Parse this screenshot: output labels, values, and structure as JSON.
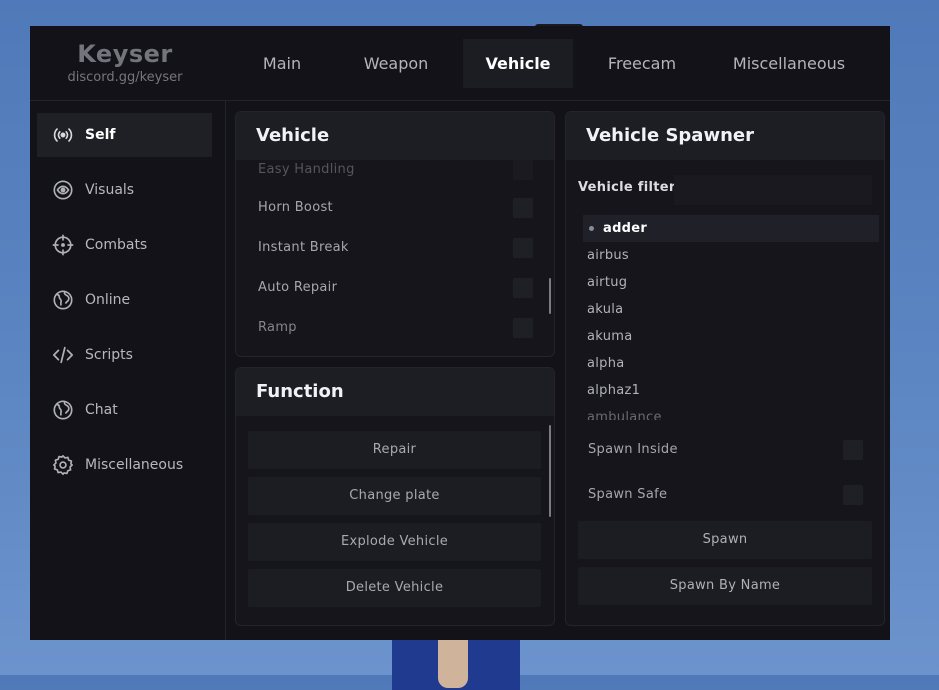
{
  "brand": {
    "title": "Keyser",
    "subtitle": "discord.gg/keyser"
  },
  "tabs": [
    {
      "label": "Main"
    },
    {
      "label": "Weapon"
    },
    {
      "label": "Vehicle",
      "active": true
    },
    {
      "label": "Freecam"
    },
    {
      "label": "Miscellaneous"
    }
  ],
  "sidebar": {
    "items": [
      {
        "label": "Self",
        "icon": "broadcast-icon",
        "active": true
      },
      {
        "label": "Visuals",
        "icon": "eye-icon"
      },
      {
        "label": "Combats",
        "icon": "crosshair-icon"
      },
      {
        "label": "Online",
        "icon": "globe-icon"
      },
      {
        "label": "Scripts",
        "icon": "code-icon"
      },
      {
        "label": "Chat",
        "icon": "globe-icon"
      },
      {
        "label": "Miscellaneous",
        "icon": "gear-icon"
      }
    ]
  },
  "vehicle_panel": {
    "title": "Vehicle",
    "options": [
      {
        "label": "Easy Handling",
        "checked": false
      },
      {
        "label": "Horn Boost",
        "checked": false
      },
      {
        "label": "Instant Break",
        "checked": false
      },
      {
        "label": "Auto Repair",
        "checked": false
      },
      {
        "label": "Ramp",
        "checked": false
      }
    ]
  },
  "function_panel": {
    "title": "Function",
    "buttons": [
      {
        "label": "Repair"
      },
      {
        "label": "Change plate"
      },
      {
        "label": "Explode Vehicle"
      },
      {
        "label": "Delete Vehicle"
      }
    ]
  },
  "spawner_panel": {
    "title": "Vehicle Spawner",
    "filter_label": "Vehicle filter",
    "filter_value": "",
    "vehicles": [
      "adder",
      "airbus",
      "airtug",
      "akula",
      "akuma",
      "alpha",
      "alphaz1",
      "ambulance"
    ],
    "selected_vehicle": "adder",
    "options": [
      {
        "label": "Spawn Inside",
        "checked": false
      },
      {
        "label": "Spawn Safe",
        "checked": false
      }
    ],
    "buttons": [
      {
        "label": "Spawn"
      },
      {
        "label": "Spawn By Name"
      }
    ]
  }
}
